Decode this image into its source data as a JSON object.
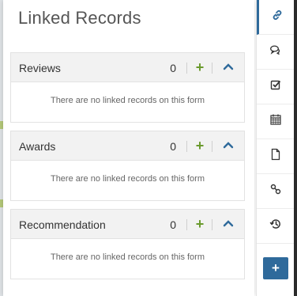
{
  "panel": {
    "title": "Linked Records"
  },
  "sections": [
    {
      "label": "Reviews",
      "count": "0",
      "add_symbol": "+",
      "empty_message": "There are no linked records on this form"
    },
    {
      "label": "Awards",
      "count": "0",
      "add_symbol": "+",
      "empty_message": "There are no linked records on this form"
    },
    {
      "label": "Recommendation",
      "count": "0",
      "add_symbol": "+",
      "empty_message": "There are no linked records on this form"
    }
  ],
  "sidebar": {
    "items": [
      {
        "icon": "link-icon",
        "active": true
      },
      {
        "icon": "comments-icon",
        "active": false
      },
      {
        "icon": "checkbox-icon",
        "active": false
      },
      {
        "icon": "calendar-icon",
        "active": false
      },
      {
        "icon": "document-icon",
        "active": false
      },
      {
        "icon": "connections-icon",
        "active": false
      },
      {
        "icon": "history-icon",
        "active": false
      }
    ],
    "add_symbol": "+"
  },
  "colors": {
    "accent": "#2f6a9b",
    "add_green": "#6a9a2d",
    "header_bg": "#f2f2f2"
  }
}
